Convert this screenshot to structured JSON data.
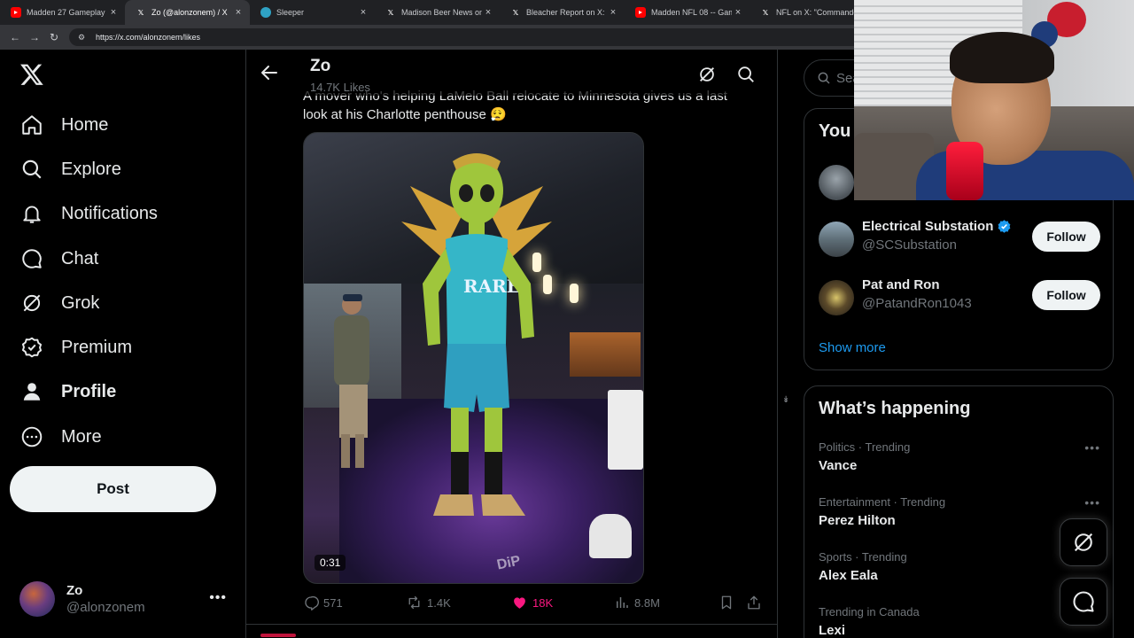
{
  "browser": {
    "tabs": [
      {
        "title": "Madden 27 Gameplay H2H",
        "favicon": "youtube-icon",
        "active": false
      },
      {
        "title": "Zo (@alonzonem) / X",
        "favicon": "x-icon",
        "active": true
      },
      {
        "title": "Sleeper",
        "favicon": "sleeper-icon",
        "active": false
      },
      {
        "title": "Madison Beer News on X:",
        "favicon": "x-icon",
        "active": false
      },
      {
        "title": "Bleacher Report on X: \"Fo",
        "favicon": "x-icon",
        "active": false
      },
      {
        "title": "Madden NFL 08 -- Gamep",
        "favicon": "youtube-icon",
        "active": false
      },
      {
        "title": "NFL on X: \"Commanders",
        "favicon": "x-icon",
        "active": false
      }
    ],
    "url": "https://x.com/alonzonem/likes"
  },
  "nav": {
    "items": [
      {
        "label": "Home",
        "icon": "home-icon"
      },
      {
        "label": "Explore",
        "icon": "search-icon"
      },
      {
        "label": "Notifications",
        "icon": "bell-icon"
      },
      {
        "label": "Chat",
        "icon": "chat-icon"
      },
      {
        "label": "Grok",
        "icon": "grok-icon"
      },
      {
        "label": "Premium",
        "icon": "verified-badge-icon"
      },
      {
        "label": "Profile",
        "icon": "person-icon"
      },
      {
        "label": "More",
        "icon": "more-circle-icon"
      }
    ],
    "post_label": "Post",
    "account": {
      "name": "Zo",
      "handle": "@alonzonem"
    }
  },
  "header": {
    "title": "Zo",
    "subtitle": "14.7K Likes"
  },
  "tweet": {
    "text_partial": "A mover who's helping LaMelo Ball relocate to Minnesota gives us a last look at his Charlotte penthouse 😮‍💨",
    "video_duration": "0:31",
    "watermark": "DiP",
    "replies": "571",
    "reposts": "1.4K",
    "likes": "18K",
    "views": "8.8M"
  },
  "search": {
    "placeholder": "Sea"
  },
  "who_to_follow": {
    "title": "You",
    "users": [
      {
        "name": "Electrical Substation",
        "handle": "@SCSubstation",
        "verified": true,
        "button": "Follow"
      },
      {
        "name": "Pat and Ron",
        "handle": "@PatandRon1043",
        "verified": false,
        "button": "Follow"
      }
    ],
    "show_more": "Show more"
  },
  "trending": {
    "title": "What’s happening",
    "items": [
      {
        "meta": "Politics · Trending",
        "name": "Vance"
      },
      {
        "meta": "Entertainment · Trending",
        "name": "Perez Hilton"
      },
      {
        "meta": "Sports · Trending",
        "name": "Alex Eala"
      },
      {
        "meta": "Trending in Canada",
        "name": "Lexi"
      }
    ]
  },
  "colors": {
    "accent": "#1d9bf0",
    "like": "#f91880",
    "background": "#000000",
    "border": "#2f3336"
  }
}
